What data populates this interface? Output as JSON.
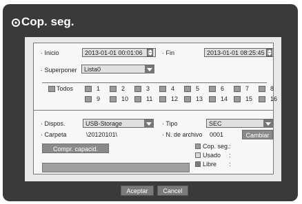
{
  "title": "Cop. seg.",
  "time": {
    "start_label": "Inicio",
    "start_value": "2013-01-01 00:01:06",
    "end_label": "Fin",
    "end_value": "2013-01-01 08:25:45"
  },
  "overlap": {
    "label": "Superponer",
    "value": "Lista0"
  },
  "channels": {
    "all_label": "Todos",
    "items": [
      "1",
      "2",
      "3",
      "4",
      "5",
      "6",
      "7",
      "8",
      "9",
      "10",
      "11",
      "12",
      "13",
      "14",
      "15",
      "16"
    ]
  },
  "backup": {
    "device_label": "Dispos.",
    "device_value": "USB-Storage",
    "type_label": "Tipo",
    "type_value": "SEC",
    "folder_label": "Carpeta",
    "folder_value": "\\20120101\\",
    "filename_label": "N. de archivo",
    "filename_value": "0001",
    "change_button": "Cambiar",
    "check_capacity_button": "Compr. capacid.",
    "legend": [
      {
        "label": "Cop. seg.",
        "value": ":",
        "color": "#9a9a9a"
      },
      {
        "label": "Usado",
        "value": ":",
        "color": "#d8d8d8"
      },
      {
        "label": "Libre",
        "value": ":",
        "color": "#7a7a7a"
      }
    ]
  },
  "buttons": {
    "accept": "Aceptar",
    "cancel": "Cancel"
  },
  "colors": {
    "dialog_bg": "#3a3a3a",
    "panel_bg": "#e8e8e8",
    "button": "#8a8a8a"
  }
}
